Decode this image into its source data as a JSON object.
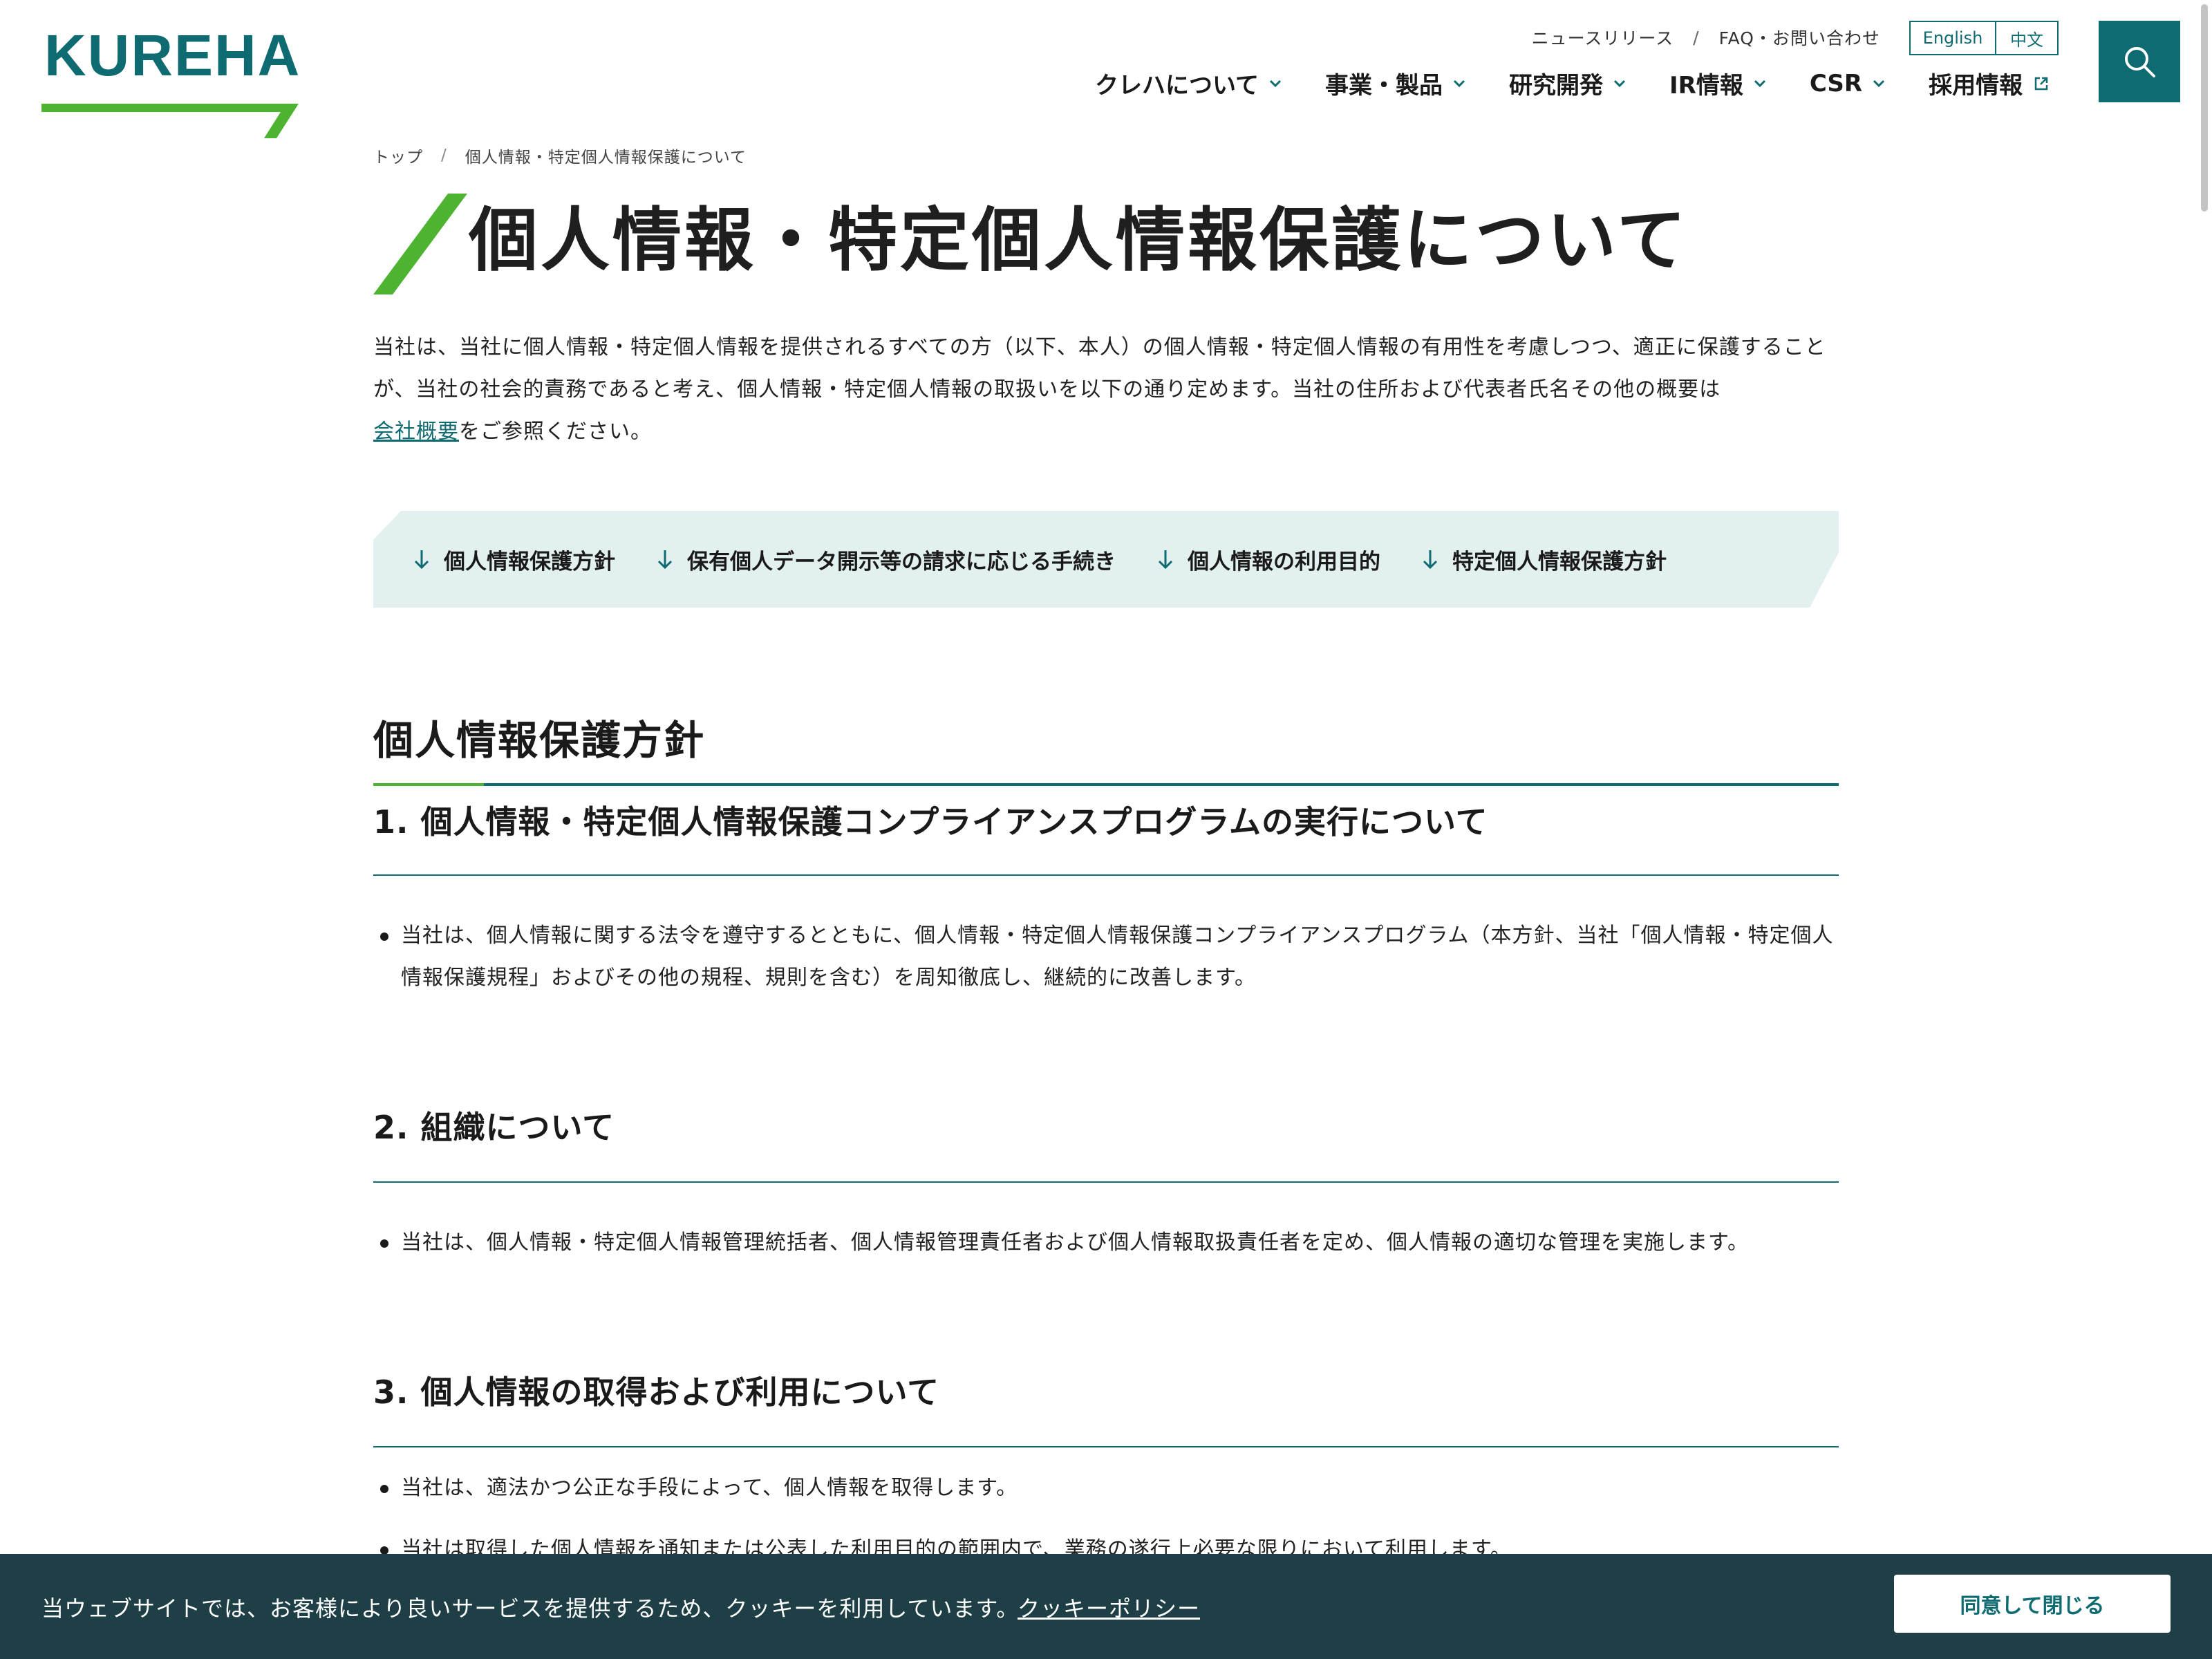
{
  "header": {
    "logo_text": "KUREHA",
    "util_links": [
      "ニュースリリース",
      "FAQ・お問い合わせ"
    ],
    "util_separator": "/",
    "languages": [
      "English",
      "中文"
    ],
    "nav": [
      "クレハについて",
      "事業・製品",
      "研究開発",
      "IR情報",
      "CSR",
      "採用情報"
    ],
    "search_icon": "search-icon"
  },
  "breadcrumb": {
    "home": "トップ",
    "separator": "/",
    "current": "個人情報・特定個人情報保護について"
  },
  "page_title": "個人情報・特定個人情報保護について",
  "intro": {
    "text_before": "当社は、当社に個人情報・特定個人情報を提供されるすべての方（以下、本人）の個人情報・特定個人情報の有用性を考慮しつつ、適正に保護することが、当社の社会的責務であると考え、個人情報・特定個人情報の取扱いを以下の通り定めます。当社の住所および代表者氏名その他の概要は",
    "link": "会社概要",
    "text_after": "をご参照ください。"
  },
  "anchor_nav": [
    "個人情報保護方針",
    "保有個人データ開示等の請求に応じる手続き",
    "個人情報の利用目的",
    "特定個人情報保護方針"
  ],
  "section": {
    "title": "個人情報保護方針",
    "subsections": [
      {
        "title": "1. 個人情報・特定個人情報保護コンプライアンスプログラムの実行について",
        "bullets": [
          "当社は、個人情報に関する法令を遵守するとともに、個人情報・特定個人情報保護コンプライアンスプログラム（本方針、当社「個人情報・特定個人情報保護規程」およびその他の規程、規則を含む）を周知徹底し、継続的に改善します。"
        ]
      },
      {
        "title": "2. 組織について",
        "bullets": [
          "当社は、個人情報・特定個人情報管理統括者、個人情報管理責任者および個人情報取扱責任者を定め、個人情報の適切な管理を実施します。"
        ]
      },
      {
        "title": "3. 個人情報の取得および利用について",
        "bullets": [
          "当社は、適法かつ公正な手段によって、個人情報を取得します。",
          "当社は取得した個人情報を通知または公表した利用目的の範囲内で、業務の遂行上必要な限りにおいて利用します。"
        ]
      }
    ]
  },
  "cookie": {
    "message": "当ウェブサイトでは、お客様により良いサービスを提供するため、クッキーを利用しています。",
    "policy_link": "クッキーポリシー",
    "accept_button": "同意して閉じる"
  },
  "colors": {
    "brand": "#0e6b72",
    "accent_green": "#4db331",
    "cookie_bg": "#1e3f45",
    "anchor_bg": "#e3f0f0"
  }
}
